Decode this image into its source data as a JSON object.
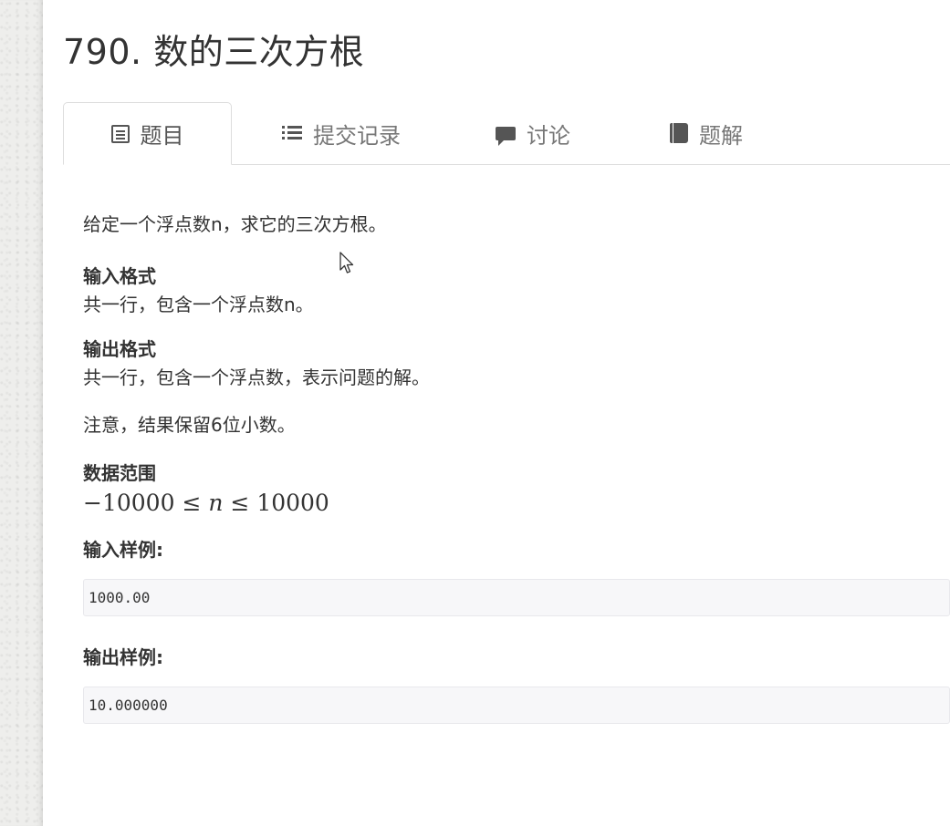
{
  "page": {
    "title": "790. 数的三次方根"
  },
  "tabs": [
    {
      "label": "题目",
      "icon": "doc-list-icon",
      "active": true
    },
    {
      "label": "提交记录",
      "icon": "list-icon",
      "active": false
    },
    {
      "label": "讨论",
      "icon": "comment-icon",
      "active": false
    },
    {
      "label": "题解",
      "icon": "book-icon",
      "active": false
    }
  ],
  "problem": {
    "description": "给定一个浮点数n，求它的三次方根。",
    "input_format_heading": "输入格式",
    "input_format": "共一行，包含一个浮点数n。",
    "output_format_heading": "输出格式",
    "output_format": "共一行，包含一个浮点数，表示问题的解。",
    "note": "注意，结果保留6位小数。",
    "range_heading": "数据范围",
    "range": {
      "lower": "−10000",
      "op1": "≤",
      "var": "n",
      "op2": "≤",
      "upper": "10000"
    },
    "sample_input_heading": "输入样例:",
    "sample_input": "1000.00",
    "sample_output_heading": "输出样例:",
    "sample_output": "10.000000"
  },
  "colors": {
    "text": "#333333",
    "tab_inactive": "#777777",
    "border": "#dddddd",
    "code_bg": "#f7f7f9"
  }
}
